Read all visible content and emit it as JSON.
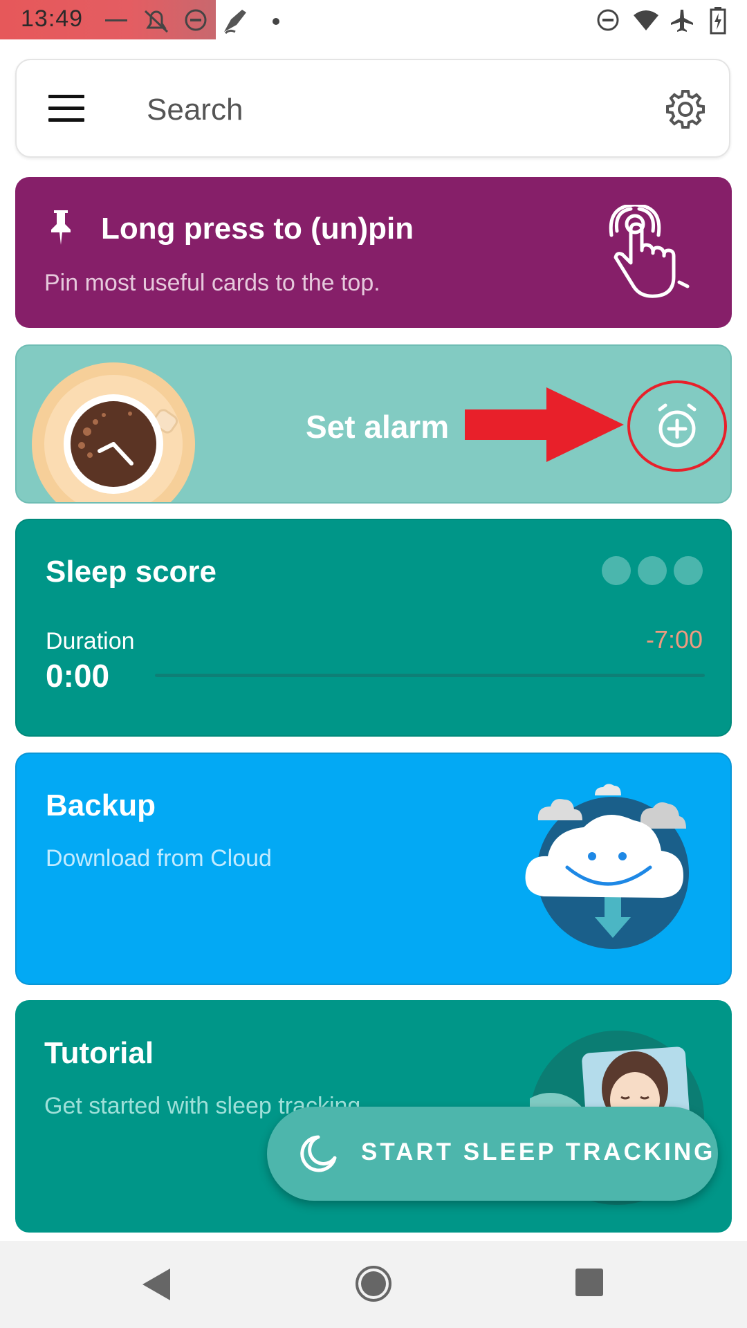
{
  "status_bar": {
    "time": "13:49"
  },
  "search": {
    "placeholder": "Search"
  },
  "pin_card": {
    "title": "Long press to (un)pin",
    "subtitle": "Pin most useful cards to the top."
  },
  "alarm_card": {
    "label": "Set alarm"
  },
  "sleep_card": {
    "title": "Sleep score",
    "duration_label": "Duration",
    "duration_value": "0:00",
    "target": "-7:00"
  },
  "backup_card": {
    "title": "Backup",
    "subtitle": "Download from Cloud"
  },
  "tutorial_card": {
    "title": "Tutorial",
    "subtitle": "Get started with sleep tracking"
  },
  "fab": {
    "label": "START SLEEP TRACKING"
  },
  "colors": {
    "pin_card": "#861f69",
    "alarm_card": "#82cbc2",
    "sleep_card": "#009688",
    "backup_card": "#03a9f4",
    "fab": "#4db6ac",
    "annotation_red": "#e8202a"
  }
}
